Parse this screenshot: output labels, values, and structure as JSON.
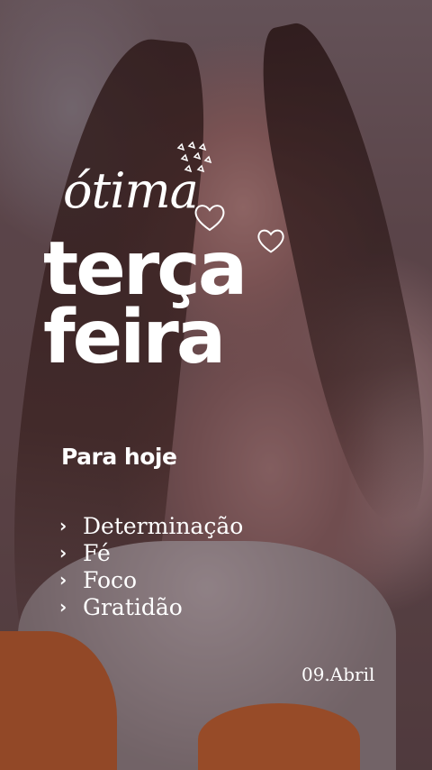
{
  "story": {
    "script_text": "ótima",
    "title_line1": "terça",
    "title_line2": "feira",
    "subtitle": "Para hoje",
    "list_items": [
      "Determinação",
      "Fé",
      "Foco",
      "Gratidão"
    ],
    "bullet_glyph": "›",
    "date": "09.Abril"
  },
  "icons": {
    "heart": "heart-icon",
    "eye_sticker": "sparkle-sticker-icon"
  },
  "colors": {
    "text": "#ffffff"
  }
}
